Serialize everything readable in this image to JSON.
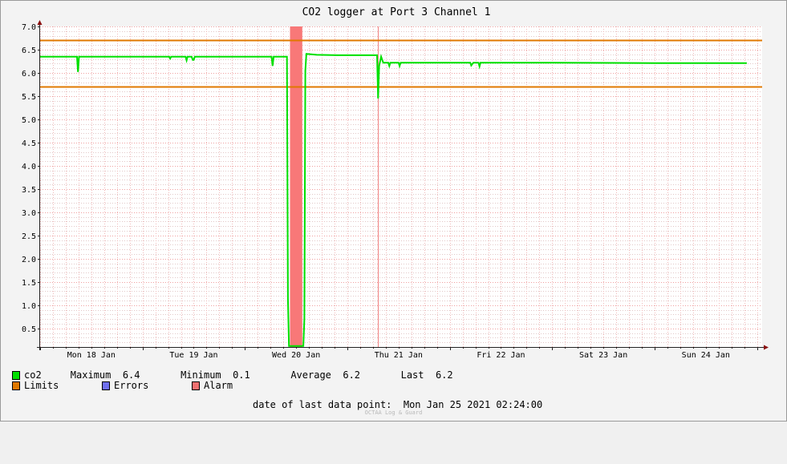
{
  "chart_data": {
    "type": "line",
    "title": "CO2 logger at Port 3 Channel 1",
    "xlabel": "",
    "ylabel": "",
    "x_range_days": [
      0,
      7.05
    ],
    "x_ticks": [
      {
        "day": 0.5,
        "label": "Mon 18 Jan"
      },
      {
        "day": 1.5,
        "label": "Tue 19 Jan"
      },
      {
        "day": 2.5,
        "label": "Wed 20 Jan"
      },
      {
        "day": 3.5,
        "label": "Thu 21 Jan"
      },
      {
        "day": 4.5,
        "label": "Fri 22 Jan"
      },
      {
        "day": 5.5,
        "label": "Sat 23 Jan"
      },
      {
        "day": 6.5,
        "label": "Sun 24 Jan"
      }
    ],
    "ylim": [
      0.1,
      7.0
    ],
    "y_ticks": [
      "0.5",
      "1.0",
      "1.5",
      "2.0",
      "2.5",
      "3.0",
      "3.5",
      "4.0",
      "4.5",
      "5.0",
      "5.5",
      "6.0",
      "6.5",
      "7.0"
    ],
    "grid": true,
    "limits": [
      5.7,
      6.7
    ],
    "alarm_band_days": [
      2.44,
      2.56
    ],
    "day_marker": 3.3,
    "series": [
      {
        "name": "co2",
        "color": "#00e000",
        "points": [
          [
            0,
            6.35
          ],
          [
            0.36,
            6.35
          ],
          [
            0.37,
            6.02
          ],
          [
            0.38,
            6.35
          ],
          [
            1.26,
            6.35
          ],
          [
            1.27,
            6.31
          ],
          [
            1.28,
            6.35
          ],
          [
            1.42,
            6.35
          ],
          [
            1.43,
            6.27
          ],
          [
            1.44,
            6.35
          ],
          [
            1.48,
            6.35
          ],
          [
            1.49,
            6.28
          ],
          [
            1.5,
            6.28
          ],
          [
            1.51,
            6.35
          ],
          [
            2.26,
            6.35
          ],
          [
            2.27,
            6.15
          ],
          [
            2.28,
            6.35
          ],
          [
            2.41,
            6.35
          ],
          [
            2.42,
            1.15
          ],
          [
            2.43,
            0.12
          ],
          [
            2.57,
            0.12
          ],
          [
            2.58,
            0.7
          ],
          [
            2.59,
            6.05
          ],
          [
            2.6,
            6.41
          ],
          [
            2.7,
            6.39
          ],
          [
            2.9,
            6.38
          ],
          [
            3.2,
            6.38
          ],
          [
            3.29,
            6.38
          ],
          [
            3.3,
            5.45
          ],
          [
            3.31,
            6.15
          ],
          [
            3.33,
            6.35
          ],
          [
            3.35,
            6.22
          ],
          [
            3.4,
            6.22
          ],
          [
            3.41,
            6.15
          ],
          [
            3.42,
            6.22
          ],
          [
            3.5,
            6.22
          ],
          [
            3.51,
            6.15
          ],
          [
            3.52,
            6.22
          ],
          [
            4.2,
            6.22
          ],
          [
            4.21,
            6.16
          ],
          [
            4.23,
            6.22
          ],
          [
            4.28,
            6.22
          ],
          [
            4.29,
            6.14
          ],
          [
            4.3,
            6.22
          ],
          [
            5.0,
            6.22
          ],
          [
            6.0,
            6.21
          ],
          [
            6.9,
            6.21
          ]
        ]
      }
    ],
    "legend_color": {
      "limits": "#e07800",
      "errors": "#7070f0",
      "alarm": "#f07070"
    }
  },
  "legend": {
    "co2_row": "co2     Maximum  6.4       Minimum  0.1       Average  6.2       Last  6.2",
    "limits_label": "Limits",
    "errors_label": "Errors",
    "alarm_label": "Alarm"
  },
  "last_point": "date of last data point:  Mon Jan 25 2021 02:24:00",
  "footer": "OCTAA Log & Guard"
}
